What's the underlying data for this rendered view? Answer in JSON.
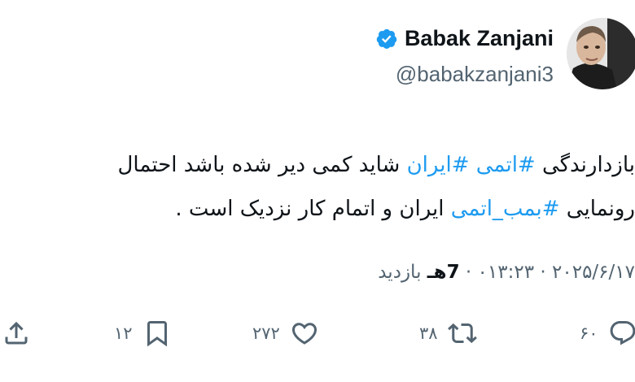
{
  "author": {
    "name": "Babak Zanjani",
    "handle": "@babakzanjani3",
    "verified": true
  },
  "tweet": {
    "line1": [
      {
        "text": "بازدارندگی ",
        "hashtag": false
      },
      {
        "text": "#اتمی",
        "hashtag": true
      },
      {
        "text": " ",
        "hashtag": false
      },
      {
        "text": "#ایران",
        "hashtag": true
      },
      {
        "text": " شاید کمی دیر شده باشد احتمال",
        "hashtag": false
      }
    ],
    "line2": [
      {
        "text": "رونمایی ",
        "hashtag": false
      },
      {
        "text": "#بمب_اتمی",
        "hashtag": true
      },
      {
        "text": " ایران و اتمام کار نزدیک است .",
        "hashtag": false
      }
    ]
  },
  "meta": {
    "date": "۲۰۲۵/۶/۱۷",
    "sep1": " · ",
    "time": "۰۱۳:۲۳",
    "sep2": " · ",
    "views": "7هـ",
    "views_label": " بازدید"
  },
  "actions": {
    "reply_count": "۶۰",
    "retweet_count": "۳۸",
    "like_count": "۲۷۲",
    "bookmark_count": "۱۲"
  },
  "colors": {
    "hashtag": "#1d9bf0",
    "secondary": "#536471",
    "text": "#0f1419",
    "badge": "#1d9bf0"
  }
}
